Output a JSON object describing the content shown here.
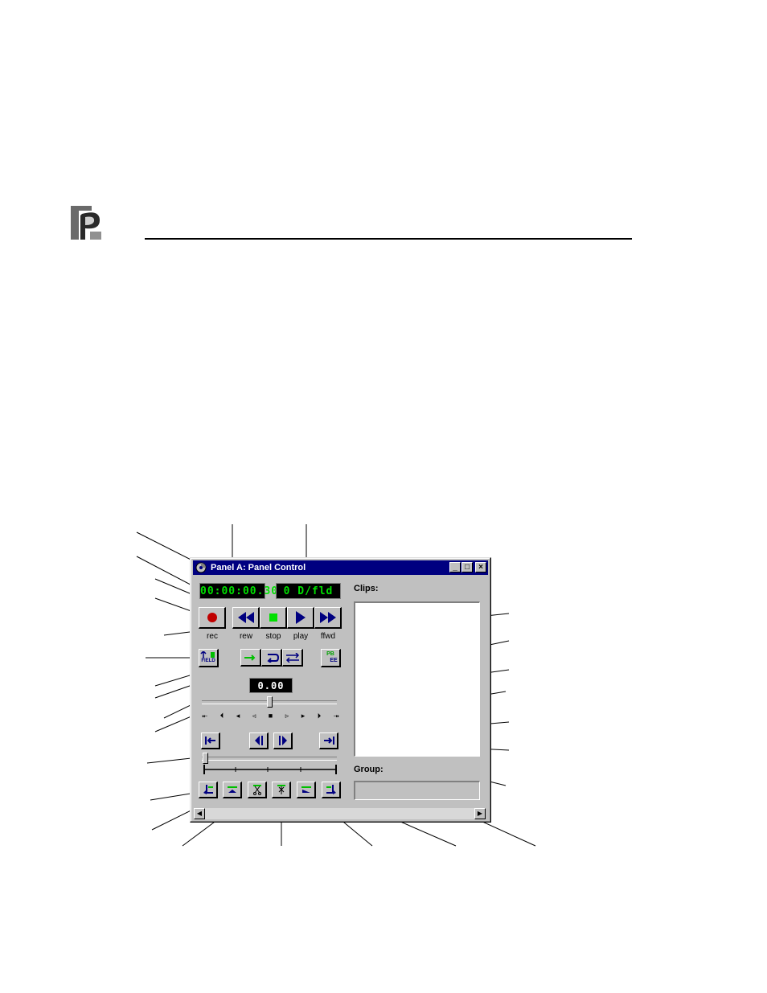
{
  "window": {
    "title": "Panel A: Panel Control",
    "minimize_glyph": "_",
    "maximize_glyph": "□",
    "close_glyph": "×"
  },
  "displays": {
    "timecode": "00:00:00.30",
    "fields": "0 D/fld",
    "speed": "0.00"
  },
  "transport": {
    "rec_label": "rec",
    "rew_label": "rew",
    "stop_label": "stop",
    "play_label": "play",
    "ffwd_label": "ffwd"
  },
  "shuttle_glyphs": [
    "⯬",
    "⏴",
    "◂",
    "◃",
    "■",
    "▹",
    "▸",
    "⏵",
    "⯮"
  ],
  "mode_buttons": {
    "field_text": "FIELD",
    "ee_text": "EE",
    "pb_text": "PB"
  },
  "clips": {
    "label": "Clips:"
  },
  "group": {
    "label": "Group:"
  },
  "colors": {
    "title_bar": "#000080",
    "lcd_green": "#00e000",
    "button_blue": "#000080",
    "record_red": "#c00000"
  }
}
